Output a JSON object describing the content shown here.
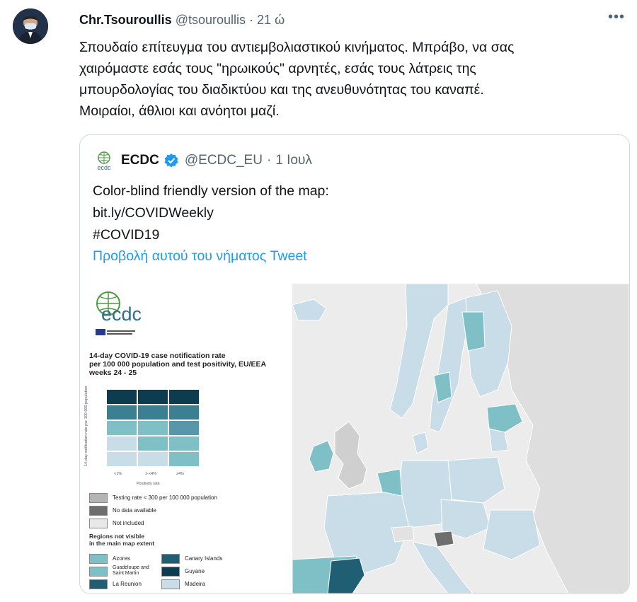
{
  "tweet": {
    "author_name": "Chr.Tsouroullis",
    "author_handle": "@tsouroullis",
    "separator": "·",
    "time": "21 ώ",
    "lines": [
      "Σπουδαίο επίτευγμα του αντιεμβολιαστικού κινήματος. Μπράβο, να σας",
      "χαιρόμαστε εσάς τους \"ηρωικούς\" αρνητές, εσάς τους λάτρεις της",
      "μπουρδολογίας του διαδικτύου και της ανευθυνότητας του καναπέ.",
      "Μοιραίοι, άθλιοι και ανόητοι μαζί."
    ],
    "more_label": "•••"
  },
  "quote": {
    "author_name": "ECDC",
    "author_handle": "@ECDC_EU",
    "separator": "·",
    "time": "1 Ιουλ",
    "lines": [
      "Color-blind friendly version of the map:",
      "bit.ly/COVIDWeekly",
      "#COVID19"
    ],
    "show_thread": "Προβολή αυτού του νήματος Tweet"
  },
  "map_image": {
    "logo_text": "ecdc",
    "title_lines": [
      "14-day COVID-19 case notification rate",
      "per 100 000 population and test positivity, EU/EEA",
      "weeks 24 - 25"
    ],
    "y_axis_label": "14-day notification rate per 100 000 population",
    "x_axis_label": "Positivity rate",
    "x_ticks": [
      "<1%",
      "1-<4%",
      "≥4%"
    ],
    "grid_colors": [
      [
        "#0d3b4f",
        "#0d3b4f",
        "#0d3b4f"
      ],
      [
        "#3b7f93",
        "#3b7f93",
        "#3b7f93"
      ],
      [
        "#7fbfc6",
        "#7fbfc6",
        "#5796ab"
      ],
      [
        "#c9dde9",
        "#7fbfc6",
        "#7fbfc6"
      ],
      [
        "#c9dde9",
        "#c9dde9",
        "#7fbfc6"
      ]
    ],
    "legend_items": [
      {
        "label": "Testing rate < 300 per 100 000 population",
        "color": "#b4b4b4"
      },
      {
        "label": "No data available",
        "color": "#6e6e6e"
      },
      {
        "label": "Not included",
        "color": "#e8e8e8"
      }
    ],
    "regions_title": [
      "Regions not visible",
      "in the main map extent"
    ],
    "regions": [
      {
        "label": "Azores",
        "color": "#7fbfc6"
      },
      {
        "label": "Canary Islands",
        "color": "#1f5e73"
      },
      {
        "label": "Guadeloupe and Saint Martin",
        "color": "#7fbfc6"
      },
      {
        "label": "Guyane",
        "color": "#0d3b4f"
      },
      {
        "label": "La Reunion",
        "color": "#1f5e73"
      },
      {
        "label": "Madeira",
        "color": "#c9dde9"
      }
    ]
  }
}
